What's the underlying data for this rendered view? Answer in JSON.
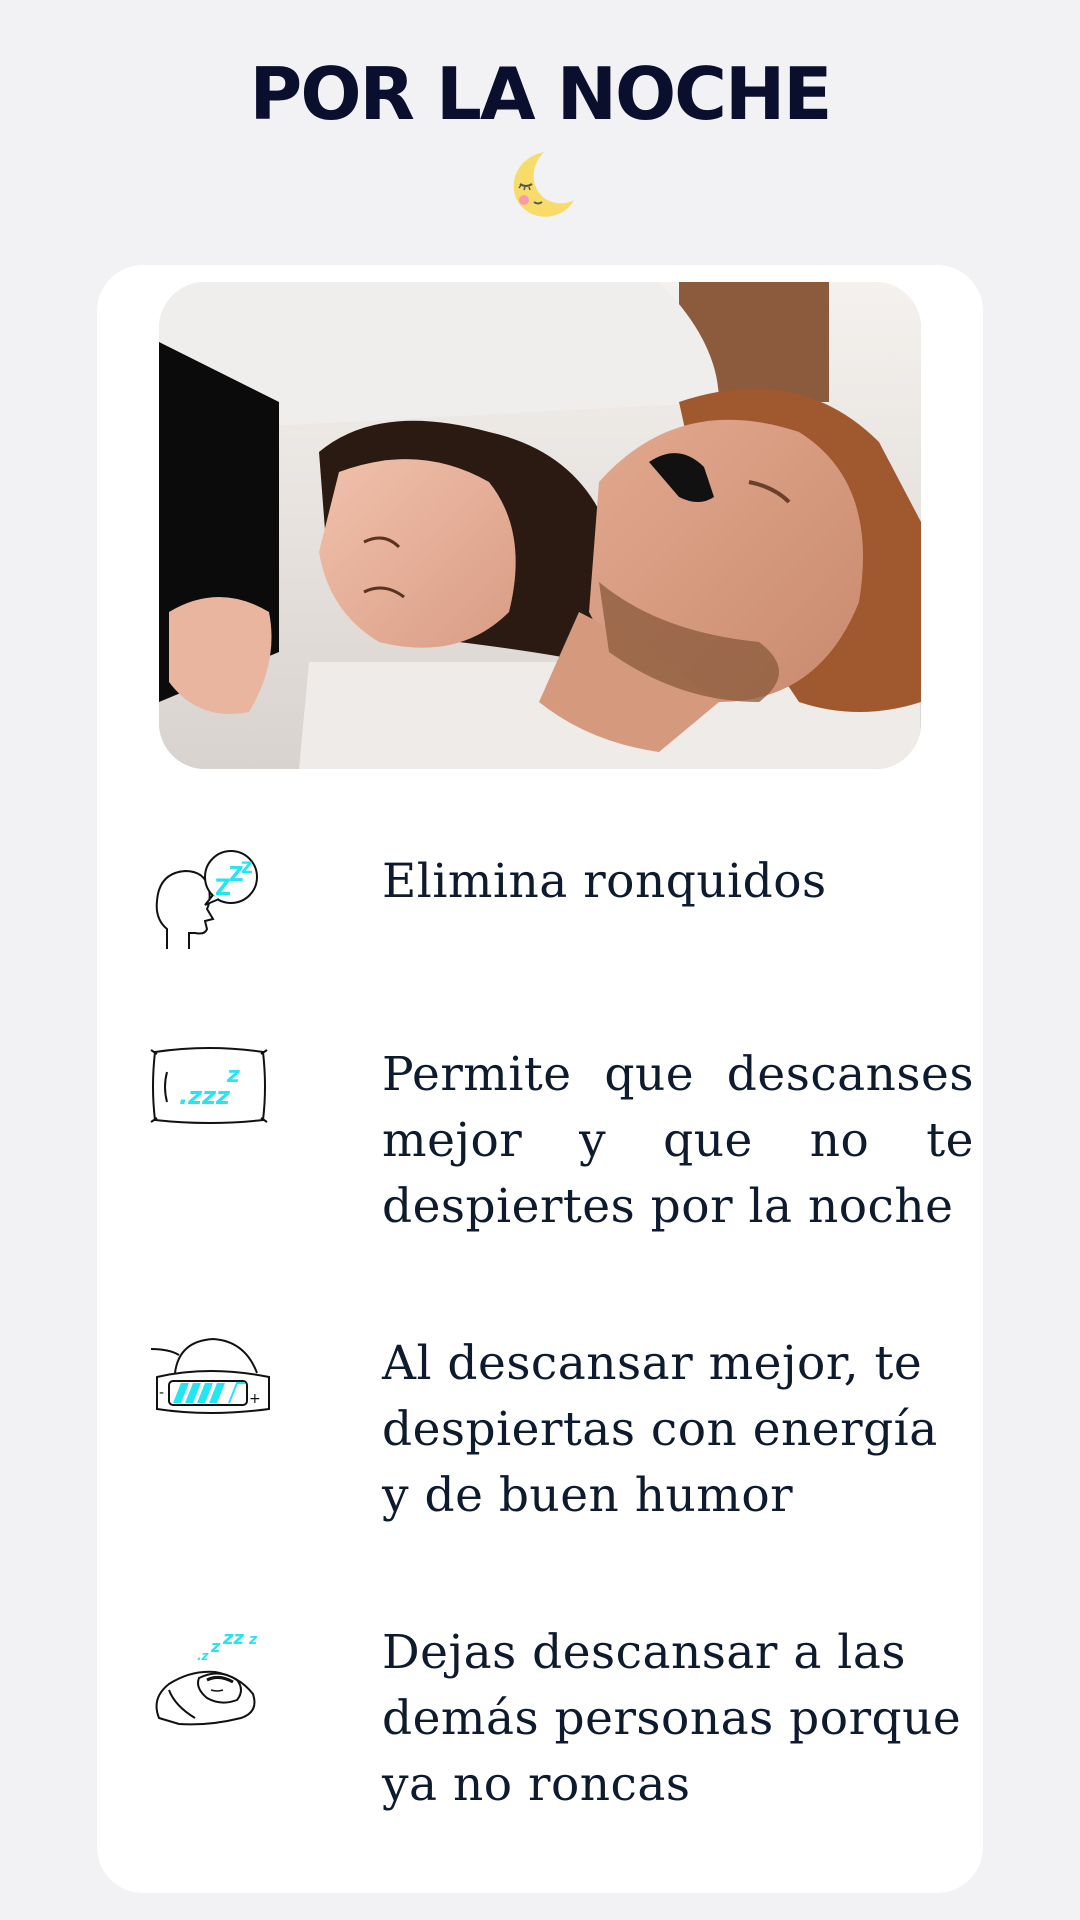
{
  "header": {
    "title": "POR LA NOCHE",
    "title_icon": "sleeping-moon-icon"
  },
  "photo": {
    "subject": "couple-sleeping-image"
  },
  "features": [
    {
      "icon": "snoring-head-icon",
      "text": "Elimina ronquidos"
    },
    {
      "icon": "pillow-zzz-icon",
      "text": "Permite que descanses mejor y que no te despiertes por la noche"
    },
    {
      "icon": "battery-sleep-icon",
      "text": "Al descansar mejor, te despiertas con energía y de buen humor"
    },
    {
      "icon": "sleeping-person-icon",
      "text": "Dejas descansar a las demás personas porque ya no roncas"
    }
  ],
  "colors": {
    "background": "#f2f2f5",
    "card": "#ffffff",
    "title": "#0b0f2e",
    "text": "#0e1a2e",
    "accent_cyan": "#22e6f2",
    "moon_yellow": "#f7dc6a"
  }
}
